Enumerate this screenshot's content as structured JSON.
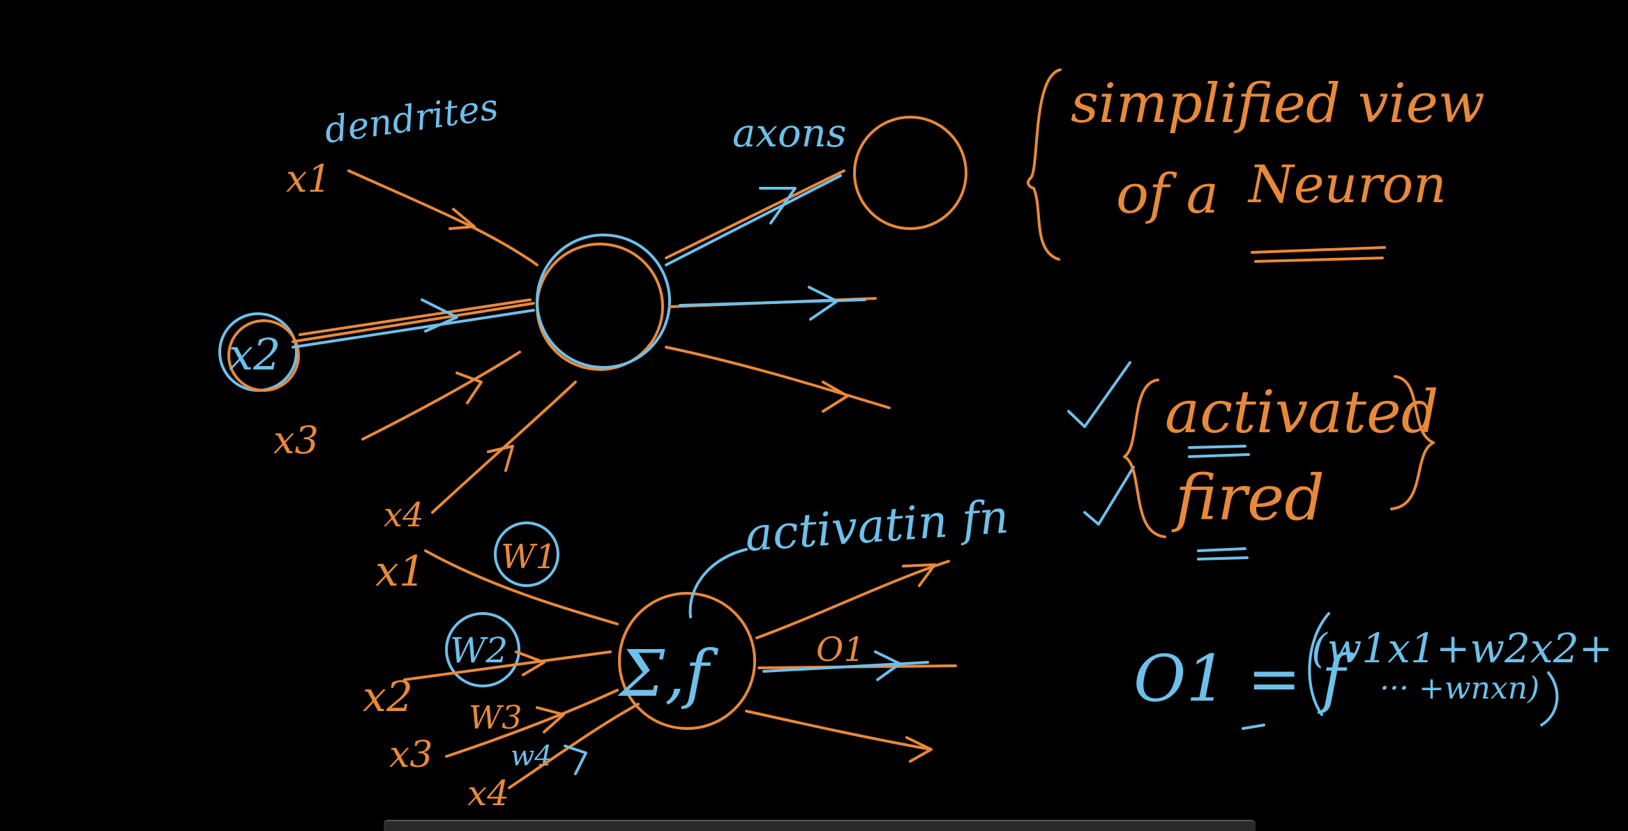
{
  "colors": {
    "background": "#000000",
    "orange_ink": "#e8893a",
    "blue_ink": "#6ec0ea"
  },
  "top": {
    "dendrites": "dendrites",
    "axons": "axons",
    "x1": "x1",
    "x2": "x2",
    "x3": "x3",
    "x4": "x4"
  },
  "bottom": {
    "x1": "x1",
    "x2": "x2",
    "x3": "x3",
    "x4": "x4",
    "w1": "W1",
    "w2": "W2",
    "w3": "W3",
    "w4": "w4",
    "node": "Σ,f",
    "activation": "activatin fn",
    "output": "O1"
  },
  "notes": {
    "simplified_line1": "simplified view",
    "simplified_line2_a": "of a",
    "simplified_line2_b": "Neuron",
    "activated": "activated",
    "fired": "fired",
    "formula_lhs": "O1 = f",
    "formula_line1": "(w1x1+w2x2+",
    "formula_line2": "··· +wnxn)"
  }
}
